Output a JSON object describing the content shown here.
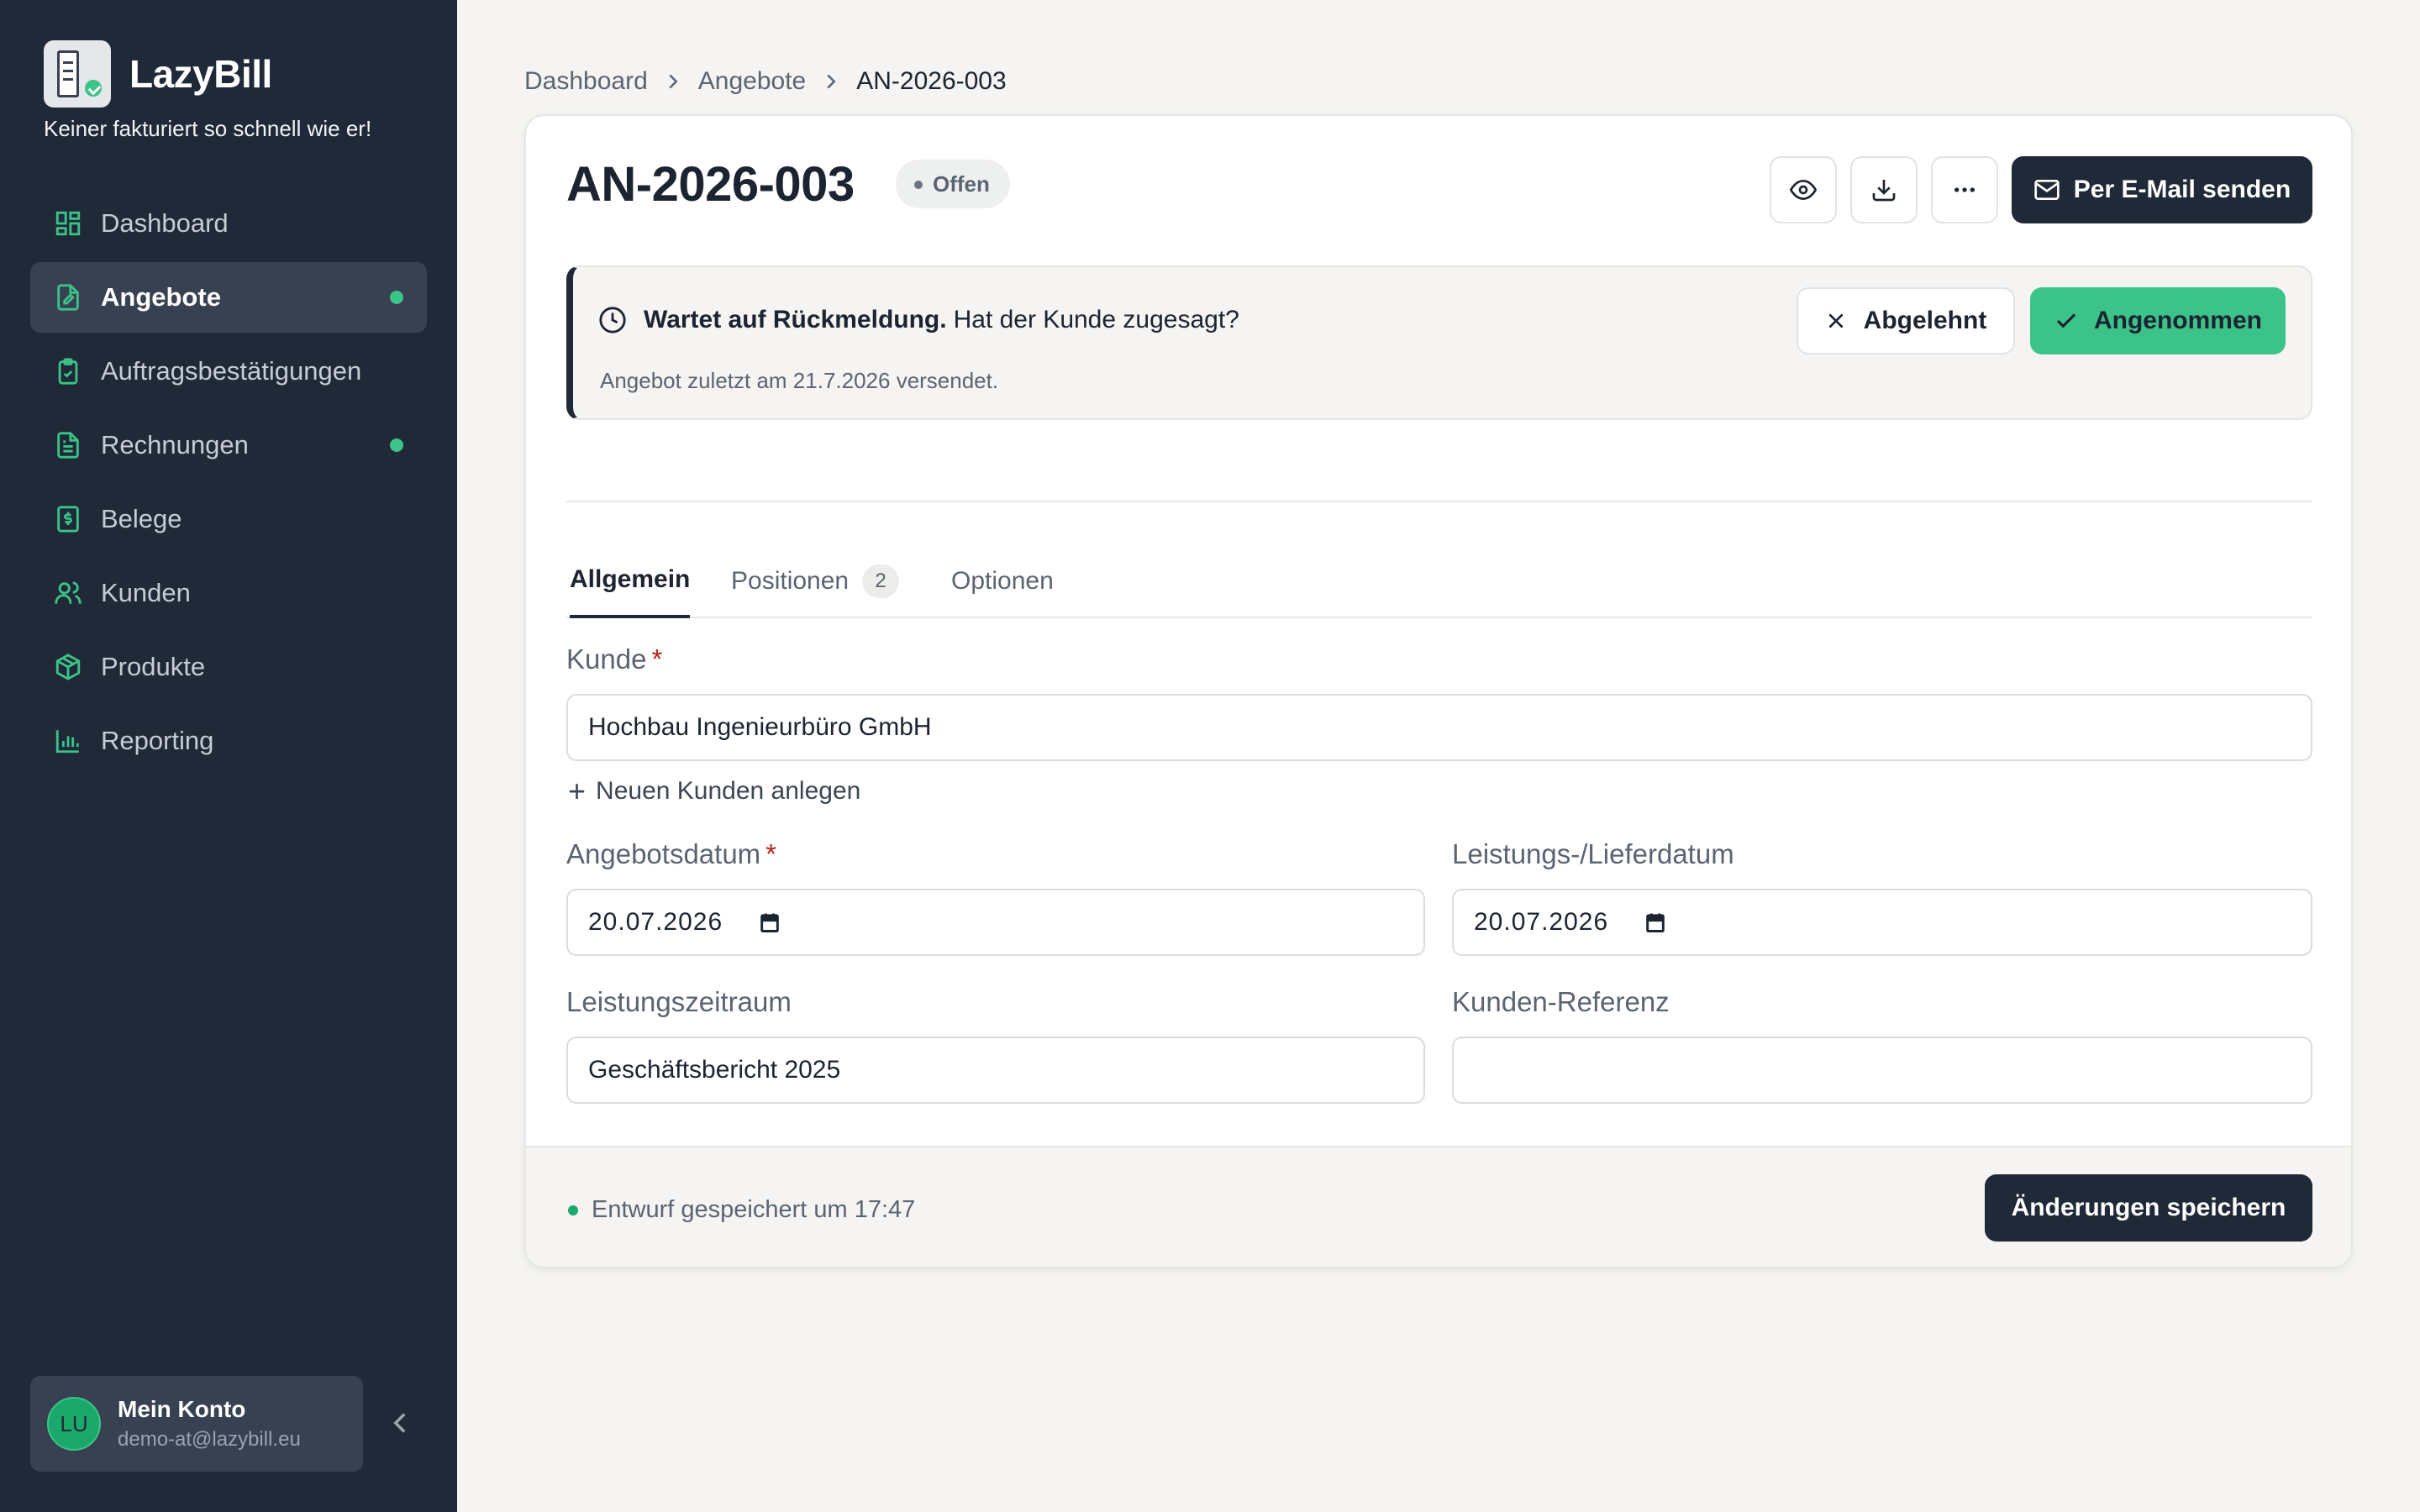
{
  "app": {
    "name": "LazyBill",
    "tagline": "Keiner fakturiert so schnell wie er!"
  },
  "sidebar": {
    "items": [
      {
        "label": "Dashboard",
        "icon": "dashboard-icon",
        "active": false,
        "dot": false
      },
      {
        "label": "Angebote",
        "icon": "quote-icon",
        "active": true,
        "dot": true
      },
      {
        "label": "Auftragsbestätigungen",
        "icon": "clipboard-check-icon",
        "active": false,
        "dot": false
      },
      {
        "label": "Rechnungen",
        "icon": "invoice-icon",
        "active": false,
        "dot": true
      },
      {
        "label": "Belege",
        "icon": "receipt-icon",
        "active": false,
        "dot": false
      },
      {
        "label": "Kunden",
        "icon": "users-icon",
        "active": false,
        "dot": false
      },
      {
        "label": "Produkte",
        "icon": "package-icon",
        "active": false,
        "dot": false
      },
      {
        "label": "Reporting",
        "icon": "bar-chart-icon",
        "active": false,
        "dot": false
      }
    ],
    "account": {
      "initials": "LU",
      "name": "Mein Konto",
      "email": "demo-at@lazybill.eu"
    }
  },
  "breadcrumb": [
    "Dashboard",
    "Angebote",
    "AN-2026-003"
  ],
  "document": {
    "number": "AN-2026-003",
    "status": "Offen",
    "send_label": "Per E-Mail senden"
  },
  "notice": {
    "title": "Wartet auf Rückmeldung.",
    "question": "Hat der Kunde zugesagt?",
    "sub": "Angebot zuletzt am 21.7.2026 versendet.",
    "decline_label": "Abgelehnt",
    "accept_label": "Angenommen"
  },
  "tabs": [
    {
      "label": "Allgemein",
      "active": true
    },
    {
      "label": "Positionen",
      "count": "2",
      "active": false
    },
    {
      "label": "Optionen",
      "active": false
    }
  ],
  "form": {
    "customer_label": "Kunde",
    "customer_value": "Hochbau Ingenieurbüro GmbH",
    "new_customer_label": "Neuen Kunden anlegen",
    "quote_date_label": "Angebotsdatum",
    "quote_date_value": "20.07.2026",
    "delivery_date_label": "Leistungs-/Lieferdatum",
    "delivery_date_value": "20.07.2026",
    "period_label": "Leistungszeitraum",
    "period_value": "Geschäftsbericht 2025",
    "reference_label": "Kunden-Referenz",
    "reference_value": "",
    "required_mark": "*"
  },
  "footer": {
    "saved_text": "Entwurf gespeichert um 17:47",
    "save_label": "Änderungen speichern"
  },
  "colors": {
    "sidebar": "#1f2937",
    "accent": "#3cc389",
    "background": "#f5f4f2"
  }
}
